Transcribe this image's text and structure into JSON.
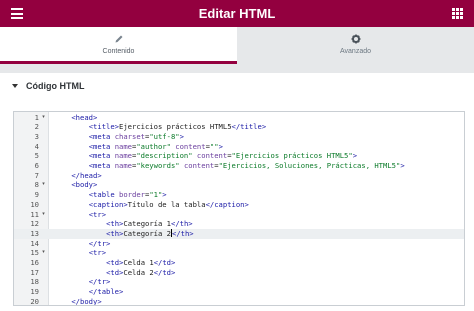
{
  "header": {
    "title": "Editar HTML",
    "menu_icon": "hamburger-icon",
    "apps_icon": "grid-icon",
    "bg_color": "#93003f"
  },
  "tabs": [
    {
      "label": "Contenido",
      "icon": "pencil-icon",
      "active": true
    },
    {
      "label": "Avanzado",
      "icon": "gear-icon",
      "active": false
    }
  ],
  "section": {
    "title": "Código HTML",
    "toggle_icon": "caret-down-icon"
  },
  "editor": {
    "highlighted_line": 13,
    "lines": [
      {
        "num": "1",
        "fold": true,
        "indent": 4,
        "tokens": [
          [
            "t",
            "<head>"
          ]
        ]
      },
      {
        "num": "2",
        "fold": false,
        "indent": 8,
        "tokens": [
          [
            "t",
            "<title>"
          ],
          [
            "x",
            "Ejercicios prácticos HTML5"
          ],
          [
            "t",
            "</title>"
          ]
        ]
      },
      {
        "num": "3",
        "fold": false,
        "indent": 8,
        "tokens": [
          [
            "t",
            "<meta "
          ],
          [
            "a",
            "charset"
          ],
          [
            "x",
            "="
          ],
          [
            "s",
            "\"utf-8\""
          ],
          [
            "t",
            ">"
          ]
        ]
      },
      {
        "num": "4",
        "fold": false,
        "indent": 8,
        "tokens": [
          [
            "t",
            "<meta "
          ],
          [
            "a",
            "name"
          ],
          [
            "x",
            "="
          ],
          [
            "s",
            "\"author\""
          ],
          [
            "x",
            " "
          ],
          [
            "a",
            "content"
          ],
          [
            "x",
            "="
          ],
          [
            "s",
            "\"\""
          ],
          [
            "t",
            ">"
          ]
        ]
      },
      {
        "num": "5",
        "fold": false,
        "indent": 8,
        "tokens": [
          [
            "t",
            "<meta "
          ],
          [
            "a",
            "name"
          ],
          [
            "x",
            "="
          ],
          [
            "s",
            "\"description\""
          ],
          [
            "x",
            " "
          ],
          [
            "a",
            "content"
          ],
          [
            "x",
            "="
          ],
          [
            "s",
            "\"Ejercicios prácticos HTML5\""
          ],
          [
            "t",
            ">"
          ]
        ]
      },
      {
        "num": "6",
        "fold": false,
        "indent": 8,
        "tokens": [
          [
            "t",
            "<meta "
          ],
          [
            "a",
            "name"
          ],
          [
            "x",
            "="
          ],
          [
            "s",
            "\"keywords\""
          ],
          [
            "x",
            " "
          ],
          [
            "a",
            "content"
          ],
          [
            "x",
            "="
          ],
          [
            "s",
            "\"Ejercicios, Soluciones, Prácticas, HTML5\""
          ],
          [
            "t",
            ">"
          ]
        ]
      },
      {
        "num": "7",
        "fold": false,
        "indent": 4,
        "tokens": [
          [
            "t",
            "</head>"
          ]
        ]
      },
      {
        "num": "8",
        "fold": true,
        "indent": 4,
        "tokens": [
          [
            "t",
            "<body>"
          ]
        ]
      },
      {
        "num": "9",
        "fold": false,
        "indent": 8,
        "tokens": [
          [
            "t",
            "<table "
          ],
          [
            "a",
            "border"
          ],
          [
            "x",
            "="
          ],
          [
            "s",
            "\"1\""
          ],
          [
            "t",
            ">"
          ]
        ]
      },
      {
        "num": "10",
        "fold": false,
        "indent": 8,
        "tokens": [
          [
            "t",
            "<caption>"
          ],
          [
            "x",
            "Título de la tabla"
          ],
          [
            "t",
            "</caption>"
          ]
        ]
      },
      {
        "num": "11",
        "fold": true,
        "indent": 8,
        "tokens": [
          [
            "t",
            "<tr>"
          ]
        ]
      },
      {
        "num": "12",
        "fold": false,
        "indent": 12,
        "tokens": [
          [
            "t",
            "<th>"
          ],
          [
            "x",
            "Categoría 1"
          ],
          [
            "t",
            "</th>"
          ]
        ]
      },
      {
        "num": "13",
        "fold": false,
        "indent": 12,
        "tokens": [
          [
            "t",
            "<th>"
          ],
          [
            "x",
            "Categoría 2"
          ],
          [
            "c",
            ""
          ],
          [
            "t",
            "</th>"
          ]
        ]
      },
      {
        "num": "14",
        "fold": false,
        "indent": 8,
        "tokens": [
          [
            "t",
            "</tr>"
          ]
        ]
      },
      {
        "num": "15",
        "fold": true,
        "indent": 8,
        "tokens": [
          [
            "t",
            "<tr>"
          ]
        ]
      },
      {
        "num": "16",
        "fold": false,
        "indent": 12,
        "tokens": [
          [
            "t",
            "<td>"
          ],
          [
            "x",
            "Celda 1"
          ],
          [
            "t",
            "</td>"
          ]
        ]
      },
      {
        "num": "17",
        "fold": false,
        "indent": 12,
        "tokens": [
          [
            "t",
            "<td>"
          ],
          [
            "x",
            "Celda 2"
          ],
          [
            "t",
            "</td>"
          ]
        ]
      },
      {
        "num": "18",
        "fold": false,
        "indent": 8,
        "tokens": [
          [
            "t",
            "</tr>"
          ]
        ]
      },
      {
        "num": "19",
        "fold": false,
        "indent": 8,
        "tokens": [
          [
            "t",
            "</table>"
          ]
        ]
      },
      {
        "num": "20",
        "fold": false,
        "indent": 4,
        "tokens": [
          [
            "t",
            "</body>"
          ]
        ]
      }
    ]
  }
}
